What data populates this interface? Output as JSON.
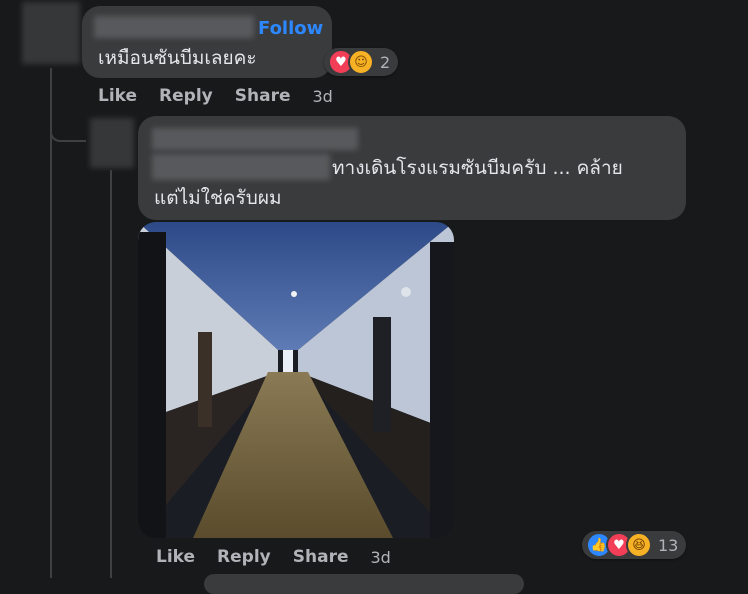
{
  "comment1": {
    "follow_label": "Follow",
    "text": "เหมือนซันบีมเลยคะ",
    "reactions": {
      "icons": [
        "heart-icon",
        "care-icon"
      ],
      "count": "2"
    },
    "actions": {
      "like": "Like",
      "reply": "Reply",
      "share": "Share",
      "time": "3d"
    }
  },
  "reply1": {
    "text_line1": "ทางเดินโรงแรมซันบีมครับ ... คล้าย",
    "text_line2": "แต่ไม่ใช่ครับผม",
    "reactions": {
      "icons": [
        "like-icon",
        "heart-icon",
        "haha-icon"
      ],
      "count": "13"
    },
    "actions": {
      "like": "Like",
      "reply": "Reply",
      "share": "Share",
      "time": "3d"
    }
  },
  "colors": {
    "bg": "#18191a",
    "bubble": "#3a3b3c",
    "link": "#2d88ff",
    "secondary": "#b0b3b8"
  }
}
